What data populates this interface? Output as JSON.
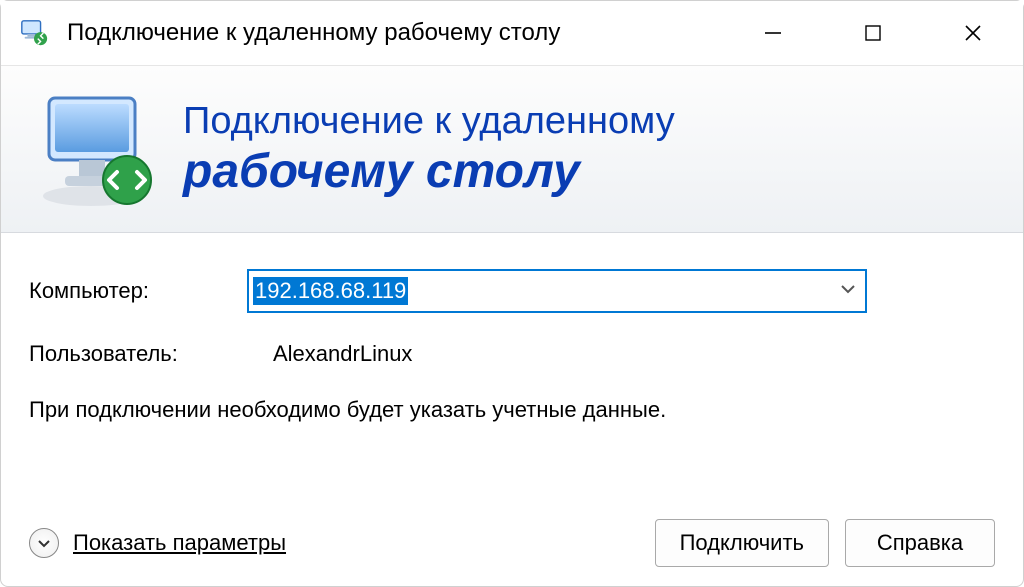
{
  "titlebar": {
    "title": "Подключение к удаленному рабочему столу"
  },
  "header": {
    "line1": "Подключение к удаленному",
    "line2": "рабочему столу"
  },
  "form": {
    "computer_label": "Компьютер:",
    "computer_value": "192.168.68.119",
    "user_label": "Пользователь:",
    "user_value": "AlexandrLinux",
    "hint": "При подключении необходимо будет указать учетные данные."
  },
  "footer": {
    "expand_label": "Показать параметры",
    "connect_label": "Подключить",
    "help_label": "Справка"
  }
}
